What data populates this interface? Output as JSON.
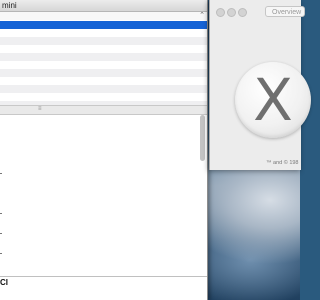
{
  "left_window": {
    "title": "mini",
    "select_caret": "⌃",
    "list_rows": 11,
    "selected_row": 0,
    "split_handle": "≡",
    "bottom_text": "CI"
  },
  "about_window": {
    "overview_label": "Overview",
    "logo_letter": "X",
    "copyright": "™ and © 198"
  }
}
